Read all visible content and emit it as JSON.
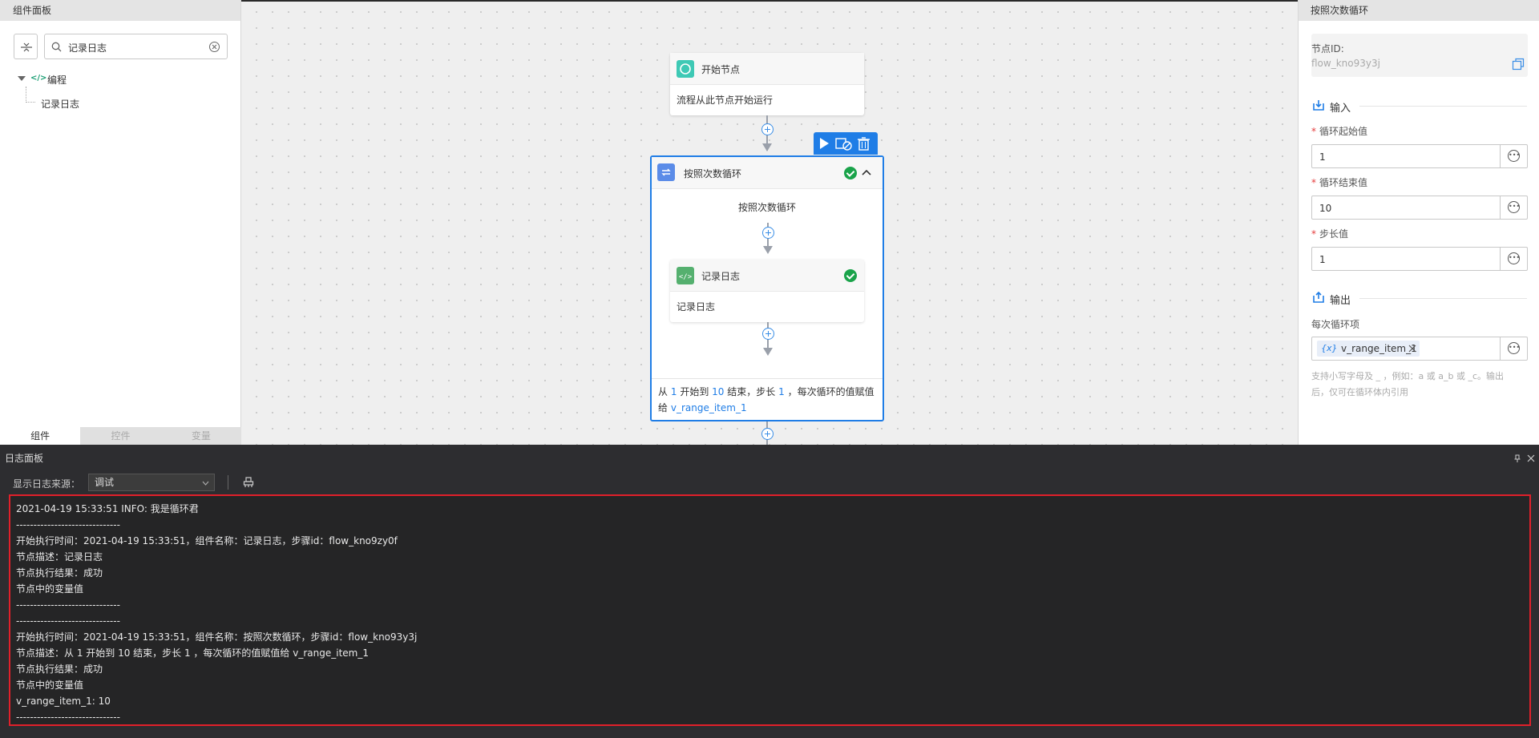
{
  "left_panel": {
    "title": "组件面板",
    "search_value": "记录日志",
    "tree": {
      "group_label": "编程",
      "child_label": "记录日志"
    },
    "tabs": [
      "组件",
      "控件",
      "变量"
    ]
  },
  "canvas": {
    "start_node": {
      "title": "开始节点",
      "description": "流程从此节点开始运行"
    },
    "loop_node": {
      "title": "按照次数循环",
      "inner_label": "按照次数循环",
      "footer_prefix": "从",
      "footer_start": "1",
      "footer_mid1": "开始到",
      "footer_end": "10",
      "footer_mid2": "结束，步长",
      "footer_step": "1",
      "footer_mid3": "，每次循环的值赋值",
      "footer_line2_prefix": "给",
      "footer_var": "v_range_item_1"
    },
    "log_node": {
      "title": "记录日志",
      "description": "记录日志"
    }
  },
  "right_panel": {
    "title": "按照次数循环",
    "node_id_label": "节点ID:",
    "node_id_value": "flow_kno93y3j",
    "input_section": "输入",
    "fields": [
      {
        "label": "循环起始值",
        "value": "1"
      },
      {
        "label": "循环结束值",
        "value": "10"
      },
      {
        "label": "步长值",
        "value": "1"
      }
    ],
    "output_section": "输出",
    "output_label": "每次循环项",
    "output_var_prefix": "{x}",
    "output_var": "v_range_item_1",
    "help_line1": "支持小写字母及 _ ，例如：a 或 a_b 或 _c。输出",
    "help_line2": "后，仅可在循环体内引用"
  },
  "log_panel": {
    "title": "日志面板",
    "source_label": "显示日志来源：",
    "source_value": "调试",
    "lines": [
      "2021-04-19 15:33:51 INFO: 我是循环君",
      "------------------------------",
      "开始执行时间：2021-04-19 15:33:51，组件名称：记录日志，步骤id：flow_kno9zy0f",
      "节点描述：记录日志",
      "节点执行结果：成功",
      "节点中的变量值",
      "------------------------------",
      "------------------------------",
      "开始执行时间：2021-04-19 15:33:51，组件名称：按照次数循环，步骤id：flow_kno93y3j",
      "节点描述：从 1 开始到 10 结束，步长 1 ，每次循环的值赋值给 v_range_item_1",
      "节点执行结果：成功",
      "节点中的变量值",
      "v_range_item_1: 10",
      "------------------------------"
    ]
  },
  "colors": {
    "accent": "#1f7de6",
    "success": "#1aa34a",
    "highlight_border": "#e0202a"
  }
}
